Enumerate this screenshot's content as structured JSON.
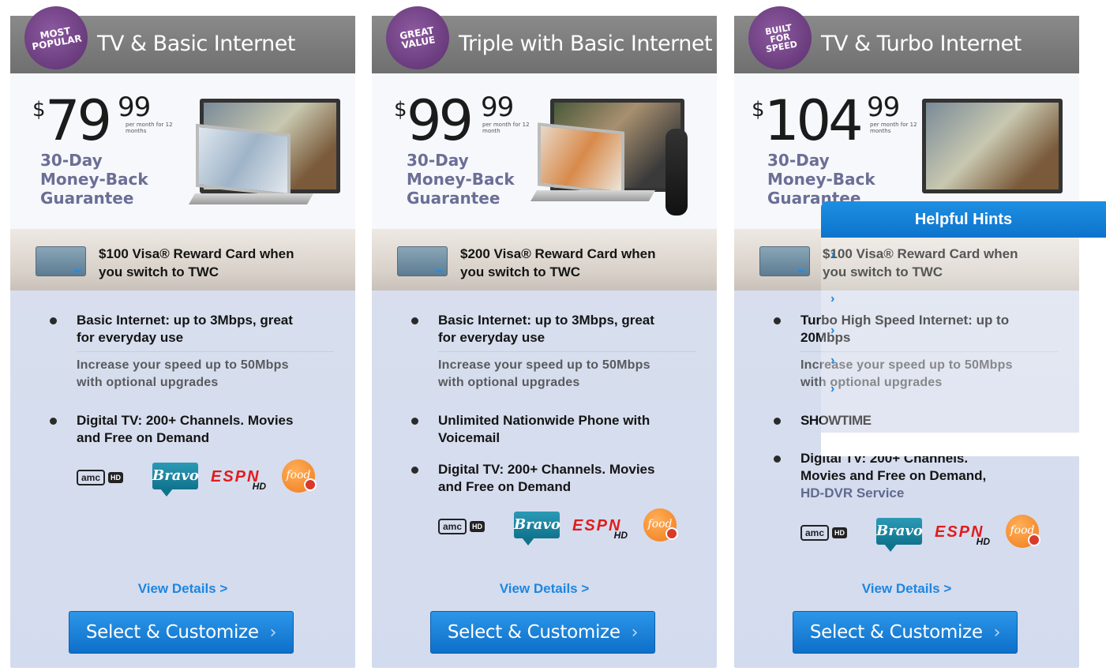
{
  "cards": [
    {
      "badge": [
        "MOST",
        "POPULAR"
      ],
      "title": "TV & Basic Internet",
      "price": {
        "dollar": "$",
        "amount": "79",
        "cents": "99",
        "per": "per month for 12 months"
      },
      "guarantee": [
        "30-Day",
        "Money-Back",
        "Guarantee"
      ],
      "reward": [
        "$100 Visa® Reward Card when",
        "you switch to TWC"
      ],
      "features": [
        {
          "main": [
            "Basic Internet: up to 3Mbps, great",
            "for everyday use"
          ],
          "sub": [
            "Increase your speed up to 50Mbps",
            "with optional upgrades"
          ]
        },
        {
          "main": [
            "Digital TV: 200+ Channels. Movies",
            "and Free on Demand"
          ]
        }
      ],
      "view_details": "View Details >",
      "select_label": "Select & Customize",
      "chevron": "›"
    },
    {
      "badge": [
        "GREAT",
        "VALUE"
      ],
      "title": "Triple with Basic Internet",
      "price": {
        "dollar": "$",
        "amount": "99",
        "cents": "99",
        "per": "per month for 12 month"
      },
      "guarantee": [
        "30-Day",
        "Money-Back",
        "Guarantee"
      ],
      "reward": [
        "$200 Visa® Reward Card when",
        "you switch to TWC"
      ],
      "features": [
        {
          "main": [
            "Basic Internet: up to 3Mbps, great",
            "for everyday use"
          ],
          "sub": [
            "Increase your speed up to 50Mbps",
            "with optional upgrades"
          ]
        },
        {
          "main": [
            "Unlimited Nationwide Phone with",
            "Voicemail"
          ]
        },
        {
          "main": [
            "Digital TV: 200+ Channels. Movies",
            "and Free on Demand"
          ]
        }
      ],
      "view_details": "View Details >",
      "select_label": "Select & Customize",
      "chevron": "›"
    },
    {
      "badge": [
        "BUILT",
        "FOR",
        "SPEED"
      ],
      "title": "TV & Turbo Internet",
      "price": {
        "dollar": "$",
        "amount": "104",
        "cents": "99",
        "per": "per month for 12 months"
      },
      "guarantee": [
        "30-Day",
        "Money-Back",
        "Guarantee"
      ],
      "reward": [
        "$100 Visa® Reward Card when",
        "you switch to TWC"
      ],
      "features": [
        {
          "main": [
            "Turbo High Speed Internet: up to",
            "20Mbps"
          ],
          "sub": [
            "Increase your speed up to 50Mbps",
            "with optional upgrades"
          ]
        },
        {
          "main": [
            "SHOWTIME"
          ]
        },
        {
          "main": [
            "Digital TV: 200+ Channels.",
            "Movies and Free on Demand,",
            "HD-DVR Service"
          ]
        }
      ],
      "view_details": "View Details >",
      "select_label": "Select & Customize",
      "chevron": "›"
    }
  ],
  "logos": {
    "amc": "amc",
    "hd": "HD",
    "bravo": "Bravo",
    "espn": "ESPN",
    "food": "food"
  },
  "helpful_hints": {
    "title": "Helpful Hints",
    "arrow": "›"
  }
}
